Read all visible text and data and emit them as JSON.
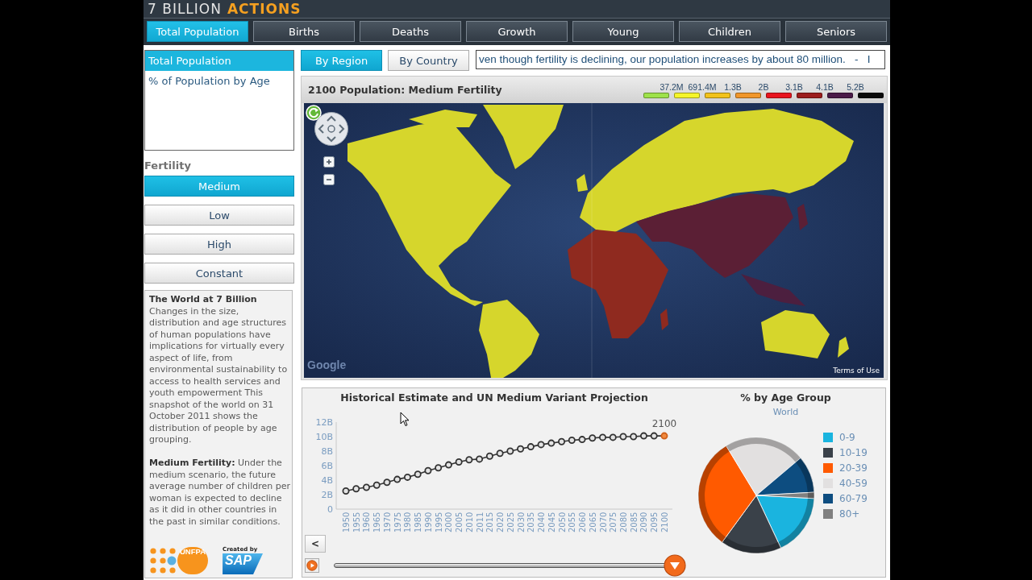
{
  "header": {
    "logo_light": "7 BILLION",
    "logo_accent": "ACTIONS"
  },
  "tabs": [
    {
      "label": "Total Population",
      "selected": true
    },
    {
      "label": "Births",
      "selected": false
    },
    {
      "label": "Deaths",
      "selected": false
    },
    {
      "label": "Growth",
      "selected": false
    },
    {
      "label": "Young",
      "selected": false
    },
    {
      "label": "Children",
      "selected": false
    },
    {
      "label": "Seniors",
      "selected": false
    }
  ],
  "sidebar": {
    "views": [
      {
        "label": "Total Population",
        "selected": true
      },
      {
        "label": "% of Population by Age",
        "selected": false
      }
    ],
    "fertility": {
      "heading": "Fertility",
      "options": [
        {
          "label": "Medium",
          "selected": true
        },
        {
          "label": "Low",
          "selected": false
        },
        {
          "label": "High",
          "selected": false
        },
        {
          "label": "Constant",
          "selected": false
        }
      ]
    },
    "info": {
      "title": "The World at 7 Billion",
      "paragraphs": [
        "Changes in the size, distribution and age structures of human populations have implications for virtually every aspect of life, from environmental sustainability to access to health services and youth empowerment  This snapshot of the world on 31 October 2011 shows the distribution of people by age grouping.",
        "**Medium Fertility:** Under the medium scenario, the future average number of children per woman is expected to decline as it did in other countries in the past in similar conditions."
      ]
    },
    "logos": {
      "partner": "UNFPA",
      "credit": "Created by",
      "creator": "SAP"
    }
  },
  "view_toggle": [
    {
      "label": "By Region",
      "selected": true
    },
    {
      "label": "By Country",
      "selected": false
    }
  ],
  "ticker": "ven though fertility is declining, our population increases by about 80 million.   -   I",
  "map_panel": {
    "title": "2100 Population: Medium Fertility",
    "legend": {
      "labels": [
        "37.2M",
        "691.4M",
        "1.3B",
        "2B",
        "3.1B",
        "4.1B",
        "5.2B"
      ],
      "swatches": [
        {
          "color": "#9ee24a"
        },
        {
          "color": "#f5f52a"
        },
        {
          "color": "#f2c21a"
        },
        {
          "color": "#f0962a"
        },
        {
          "color": "#e8141e"
        },
        {
          "color": "#9c1c1c"
        },
        {
          "color": "#4a1a48"
        },
        {
          "color": "#0a0a0a"
        }
      ]
    },
    "attribution": "Google",
    "terms": "Terms of Use"
  },
  "chart_panel": {
    "line_chart": {
      "chart_data": {
        "type": "line",
        "title": "Historical Estimate and UN Medium Variant Projection",
        "categories": [
          "1950",
          "1955",
          "1960",
          "1965",
          "1970",
          "1975",
          "1980",
          "1985",
          "1990",
          "1995",
          "2000",
          "2005",
          "2010",
          "2011",
          "2015",
          "2020",
          "2025",
          "2030",
          "2035",
          "2040",
          "2045",
          "2050",
          "2055",
          "2060",
          "2065",
          "2070",
          "2075",
          "2080",
          "2085",
          "2090",
          "2095",
          "2100"
        ],
        "series": [
          {
            "color": "#333333",
            "marker": "circle",
            "values": [
              2.5,
              2.8,
              3.0,
              3.3,
              3.7,
              4.1,
              4.4,
              4.8,
              5.3,
              5.7,
              6.1,
              6.5,
              6.8,
              6.9,
              7.3,
              7.7,
              8.0,
              8.3,
              8.6,
              8.9,
              9.1,
              9.3,
              9.5,
              9.6,
              9.8,
              9.9,
              9.9,
              10.0,
              10.0,
              10.1,
              10.1,
              10.1
            ]
          }
        ],
        "ylim": [
          0,
          12
        ],
        "yticks": [
          {
            "value": 0,
            "label": "0"
          },
          {
            "value": 2,
            "label": "2B"
          },
          {
            "value": 4,
            "label": "4B"
          },
          {
            "value": 6,
            "label": "6B"
          },
          {
            "value": 8,
            "label": "8B"
          },
          {
            "value": 10,
            "label": "10B"
          },
          {
            "value": 12,
            "label": "12B"
          }
        ]
      },
      "point_label": "2100"
    },
    "playback": {
      "back": "<",
      "level": 1
    },
    "age_chart": {
      "title": "% by Age Group",
      "subtitle": "World",
      "legend": [
        {
          "label": "0-9",
          "color": "#1ab4df"
        },
        {
          "label": "10-19",
          "color": "#3a4149"
        },
        {
          "label": "20-39",
          "color": "#ff5a00"
        },
        {
          "label": "40-59",
          "color": "#e2e0e0"
        },
        {
          "label": "60-79",
          "color": "#0d4d80"
        },
        {
          "label": "80+",
          "color": "#808080"
        }
      ]
    }
  }
}
